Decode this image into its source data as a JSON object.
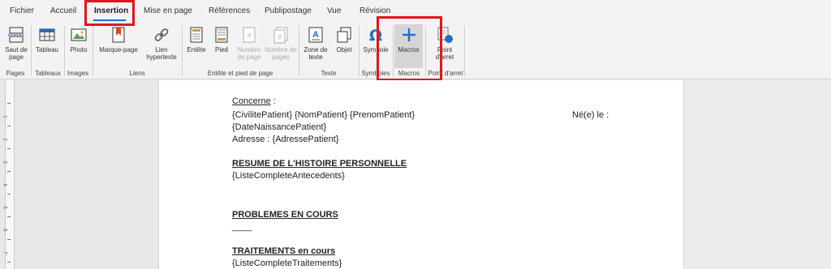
{
  "tabs": [
    "Fichier",
    "Accueil",
    "Insertion",
    "Mise en page",
    "Références",
    "Publipostage",
    "Vue",
    "Révision"
  ],
  "ribbon": {
    "buttons": {
      "saut_de_page": "Saut de page",
      "tableau": "Tableau",
      "photo": "Photo",
      "marque_page": "Marque-page",
      "lien_hypertexte": "Lien hypertexte",
      "entete": "Entête",
      "pied": "Pied",
      "numero_de_page": "Numéro de page",
      "nombre_de_pages": "Nombre de pages",
      "zone_de_texte": "Zone de texte",
      "objet": "Objet",
      "symbole": "Symbole",
      "macros": "Macros",
      "point_darret": "Point d'arret"
    },
    "groups": {
      "pages": "Pages",
      "tableaux": "Tableaux",
      "images": "Images",
      "liens": "Liens",
      "entete_pied": "Entête et pied de page",
      "texte": "Texte",
      "symboles": "Symboles",
      "macros": "Macros",
      "point_darret": "Point d'arret"
    }
  },
  "document": {
    "concerne": "Concerne",
    "concerne_colon": " :",
    "patient_line": "{CivilitePatient} {NomPatient} {PrenomPatient}",
    "ne_le": "Né(e) le :",
    "date_naissance": "{DateNaissancePatient}",
    "adresse": "Adresse  : {AdressePatient}",
    "resume_heading": "RESUME DE L'HISTOIRE PERSONNELLE",
    "antecedents": "{ListeCompleteAntecedents}",
    "problemes_heading": "PROBLEMES EN COURS",
    "problemes_line": "____",
    "traitements_heading": "TRAITEMENTS en cours",
    "traitements": "{ListeCompleteTraitements}"
  },
  "ruler": {
    "numbers": [
      "1",
      "2",
      "3",
      "4",
      "5",
      "6",
      "7"
    ]
  },
  "colors": {
    "accent": "#1e6fc8",
    "annotation": "#e0161e",
    "page": "#ffffff",
    "ribbon": "#f3f3f3"
  }
}
